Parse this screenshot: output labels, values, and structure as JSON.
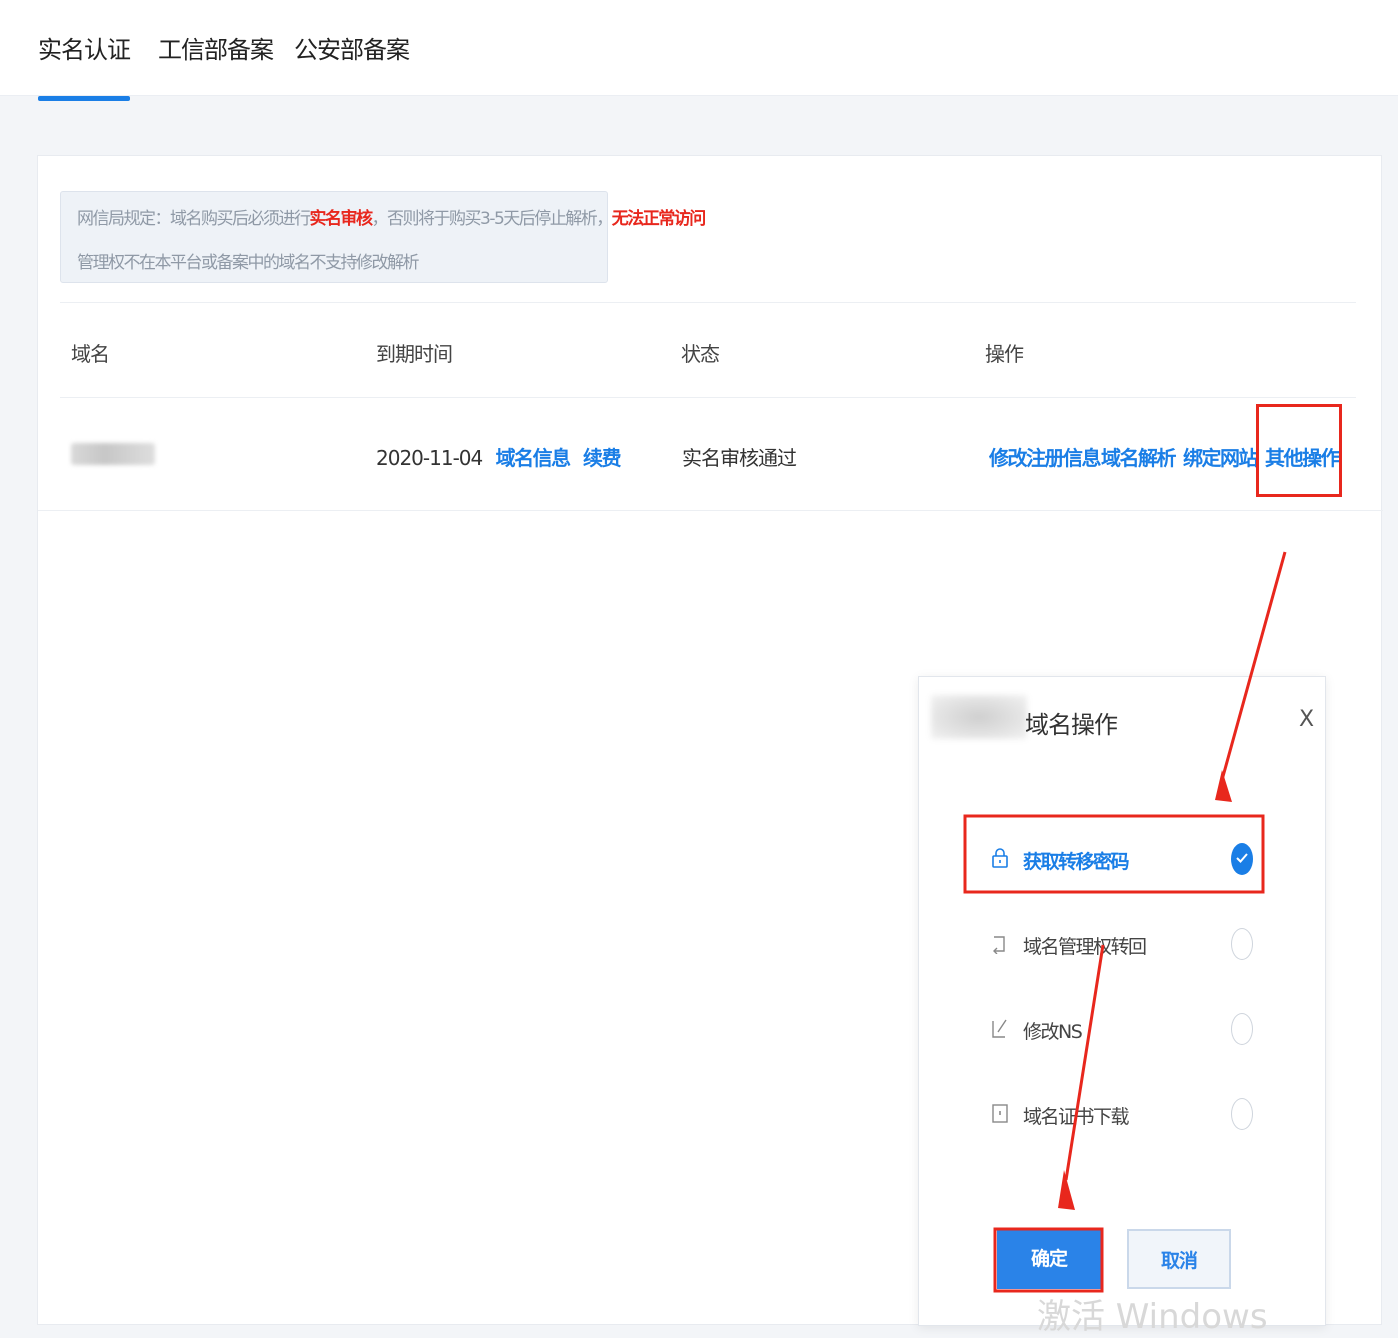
{
  "tabs": [
    {
      "label": "实名认证",
      "active": true
    },
    {
      "label": "工信部备案",
      "active": false
    },
    {
      "label": "公安部备案",
      "active": false
    }
  ],
  "notice": {
    "line1_prefix": "网信局规定：域名购买后必须进行",
    "line1_red1": "实名审核",
    "line1_middle": "，否则将于购买3-5天后停止解析，",
    "line1_red2": "无法正常访问",
    "line2": "管理权不在本平台或备案中的域名不支持修改解析"
  },
  "table": {
    "headers": [
      "域名",
      "到期时间",
      "状态",
      "操作"
    ],
    "row": {
      "expiry": "2020-11-04",
      "expiry_links": [
        "域名信息",
        "续费"
      ],
      "status": "实名审核通过",
      "actions": [
        "修改注册信息",
        "域名解析",
        "绑定网站",
        "其他操作"
      ]
    }
  },
  "modal": {
    "title": "域名操作",
    "close": "X",
    "options": [
      {
        "label": "获取转移密码",
        "icon": "lock-icon",
        "selected": true
      },
      {
        "label": "域名管理权转回",
        "icon": "return-icon",
        "selected": false
      },
      {
        "label": "修改NS",
        "icon": "edit-icon",
        "selected": false
      },
      {
        "label": "域名证书下载",
        "icon": "download-icon",
        "selected": false
      }
    ],
    "ok_label": "确定",
    "cancel_label": "取消"
  },
  "watermark": "激活 Windows",
  "colors": {
    "accent": "#1a7ee6",
    "highlight_red": "#e8271d"
  }
}
